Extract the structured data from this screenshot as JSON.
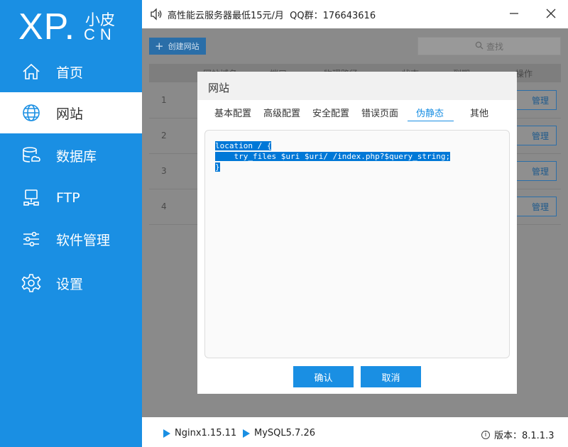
{
  "logo": {
    "main": "XP.",
    "small": "小皮",
    "sub": "CN"
  },
  "sidebar": {
    "items": [
      {
        "label": "首页",
        "icon": "home-icon"
      },
      {
        "label": "网站",
        "icon": "globe-icon",
        "active": true
      },
      {
        "label": "数据库",
        "icon": "database-icon"
      },
      {
        "label": "FTP",
        "icon": "ftp-icon"
      },
      {
        "label": "软件管理",
        "icon": "sliders-icon"
      },
      {
        "label": "设置",
        "icon": "gear-icon"
      }
    ]
  },
  "titlebar": {
    "notice": "高性能云服务器最低15元/月  QQ群：176643616"
  },
  "toolbar": {
    "create_label": "创建网站",
    "search_label": "查找"
  },
  "table": {
    "headers": [
      "网站域名",
      "端口",
      "物理路径",
      "状态",
      "到期",
      "操作"
    ],
    "rows": [
      {
        "num": "1",
        "action": "管理"
      },
      {
        "num": "2",
        "action": "管理"
      },
      {
        "num": "3",
        "action": "管理"
      },
      {
        "num": "4",
        "action": "管理"
      }
    ]
  },
  "dialog": {
    "title": "网站",
    "tabs": [
      "基本配置",
      "高级配置",
      "安全配置",
      "错误页面",
      "伪静态",
      "其他"
    ],
    "active_tab": "伪静态",
    "code_lines": [
      "location / {",
      "    try_files $uri $uri/ /index.php?$query_string;",
      "}"
    ],
    "confirm_label": "确认",
    "cancel_label": "取消"
  },
  "statusbar": {
    "nginx": "Nginx1.15.11",
    "mysql": "MySQL5.7.26",
    "version": "版本：8.1.1.3"
  },
  "colors": {
    "accent": "#1a8fe3",
    "selection": "#0078d7"
  }
}
